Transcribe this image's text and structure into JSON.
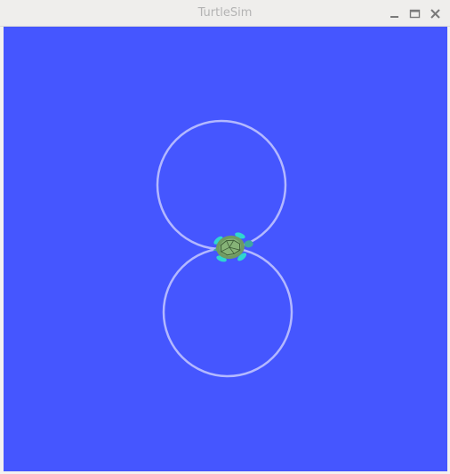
{
  "window": {
    "title": "TurtleSim",
    "controls": {
      "minimize_icon": "minimize-icon",
      "maximize_icon": "maximize-icon",
      "close_icon": "close-icon"
    }
  },
  "canvas": {
    "background_color": "#4556ff",
    "pen_color": "#b3b8ff",
    "turtle_icon": "turtle-icon"
  }
}
